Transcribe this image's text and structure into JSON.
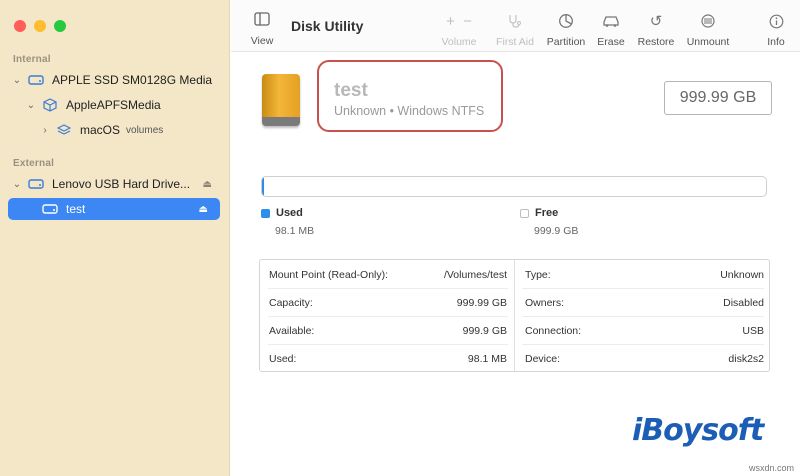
{
  "window": {
    "title": "Disk Utility"
  },
  "sidebar": {
    "internal_label": "Internal",
    "external_label": "External",
    "items": [
      {
        "label": "APPLE SSD SM0128G Media",
        "icon": "hard-drive-icon"
      },
      {
        "label": "AppleAPFSMedia",
        "icon": "cube-container-icon"
      },
      {
        "label": "macOS",
        "suffix": "volumes",
        "icon": "layers-icon"
      },
      {
        "label": "Lenovo USB Hard Drive...",
        "icon": "hard-drive-icon"
      },
      {
        "label": "test",
        "icon": "drive-icon"
      }
    ]
  },
  "toolbar": {
    "view": "View",
    "volume": "Volume",
    "first_aid": "First Aid",
    "partition": "Partition",
    "erase": "Erase",
    "restore": "Restore",
    "unmount": "Unmount",
    "info": "Info"
  },
  "volume": {
    "name": "test",
    "subtitle": "Unknown • Windows NTFS",
    "size": "999.99 GB"
  },
  "usage": {
    "used_label": "Used",
    "used_value": "98.1 MB",
    "free_label": "Free",
    "free_value": "999.9 GB",
    "used_fraction": 0.0001,
    "used_color": "#2b8ee8"
  },
  "info": {
    "left": [
      {
        "key": "Mount Point (Read-Only):",
        "value": "/Volumes/test"
      },
      {
        "key": "Capacity:",
        "value": "999.99 GB"
      },
      {
        "key": "Available:",
        "value": "999.9 GB"
      },
      {
        "key": "Used:",
        "value": "98.1 MB"
      }
    ],
    "right": [
      {
        "key": "Type:",
        "value": "Unknown"
      },
      {
        "key": "Owners:",
        "value": "Disabled"
      },
      {
        "key": "Connection:",
        "value": "USB"
      },
      {
        "key": "Device:",
        "value": "disk2s2"
      }
    ]
  },
  "watermark": {
    "brand": "iBoysoft",
    "site": "wsxdn.com"
  }
}
